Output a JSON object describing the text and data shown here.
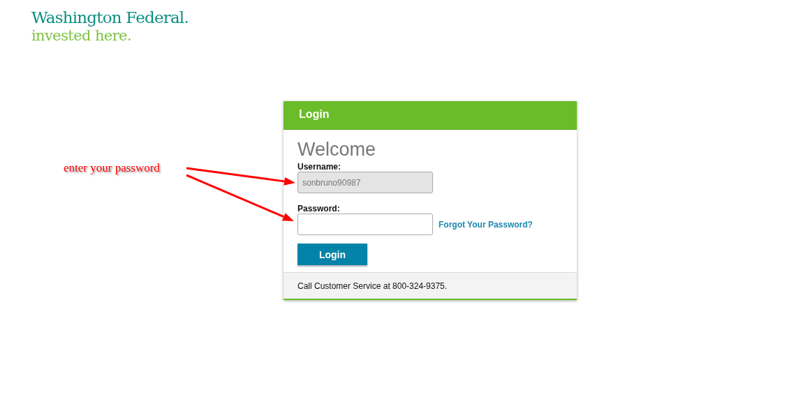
{
  "logo": {
    "name": "Washington Federal.",
    "tagline": "invested here."
  },
  "annotation": {
    "text": "enter your password"
  },
  "login_panel": {
    "title": "Login",
    "heading": "Welcome",
    "username": {
      "label": "Username:",
      "value": "sonbruno90987",
      "disabled": true
    },
    "password": {
      "label": "Password:",
      "disabled": false
    },
    "forgot_link": "Forgot Your Password?",
    "submit_button": "Login",
    "footer": "Call Customer Service at 800-324-9375."
  }
}
